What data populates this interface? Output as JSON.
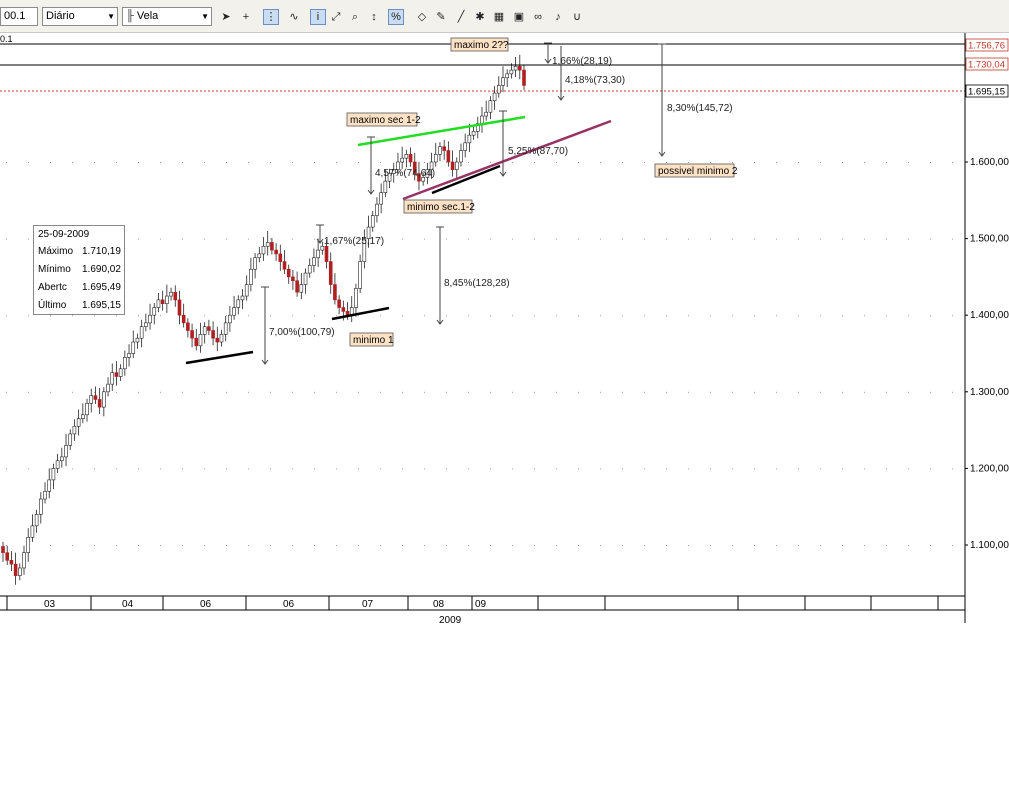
{
  "toolbar": {
    "symbol_value": "00.1",
    "period_value": "Diário",
    "style_value": "Vela",
    "symbol_short": "0.1"
  },
  "info_box": {
    "date": "25-09-2009",
    "rows": [
      {
        "label": "Máximo",
        "value": "1.710,19"
      },
      {
        "label": "Mínimo",
        "value": "1.690,02"
      },
      {
        "label": "Abertc",
        "value": "1.695,49"
      },
      {
        "label": "Último",
        "value": "1.695,15"
      }
    ]
  },
  "chart_data": {
    "type": "candlestick",
    "y_axis": {
      "ticks": [
        "1.100,00",
        "1.200,00",
        "1.300,00",
        "1.400,00",
        "1.500,00",
        "1.600,00"
      ],
      "tick_values": [
        1100,
        1200,
        1300,
        1400,
        1500,
        1600
      ],
      "ylim": [
        1035,
        1790
      ],
      "price_tags": [
        {
          "label": "1.756,76",
          "value": 1756.76,
          "color": "#c0392b"
        },
        {
          "label": "1.730,04",
          "value": 1730.04,
          "color": "#c0392b"
        },
        {
          "label": "1.695,15",
          "value": 1695.15,
          "color": "#000000"
        }
      ]
    },
    "x_axis": {
      "month_labels": [
        "03",
        "04",
        "06",
        "06",
        "07",
        "08",
        "09"
      ],
      "year_label": "2009"
    },
    "closes": [
      1090,
      1080,
      1075,
      1060,
      1070,
      1090,
      1110,
      1125,
      1140,
      1160,
      1170,
      1185,
      1200,
      1210,
      1215,
      1230,
      1245,
      1255,
      1265,
      1270,
      1285,
      1295,
      1290,
      1280,
      1300,
      1310,
      1325,
      1320,
      1330,
      1345,
      1350,
      1365,
      1370,
      1385,
      1390,
      1400,
      1410,
      1420,
      1415,
      1425,
      1430,
      1420,
      1400,
      1390,
      1380,
      1370,
      1360,
      1375,
      1385,
      1380,
      1370,
      1365,
      1375,
      1390,
      1400,
      1410,
      1420,
      1425,
      1440,
      1460,
      1475,
      1480,
      1490,
      1495,
      1485,
      1480,
      1470,
      1460,
      1450,
      1445,
      1430,
      1440,
      1455,
      1465,
      1475,
      1485,
      1490,
      1470,
      1440,
      1420,
      1410,
      1405,
      1400,
      1410,
      1435,
      1470,
      1500,
      1515,
      1530,
      1545,
      1560,
      1575,
      1585,
      1590,
      1600,
      1605,
      1610,
      1600,
      1585,
      1575,
      1580,
      1590,
      1600,
      1610,
      1620,
      1615,
      1600,
      1590,
      1600,
      1615,
      1625,
      1635,
      1640,
      1650,
      1660,
      1665,
      1680,
      1690,
      1700,
      1710,
      1715,
      1720,
      1725,
      1720,
      1700
    ],
    "annotations": {
      "labels": [
        "maximo 2??",
        "maximo sec 1-2",
        "minimo sec.1-2",
        "minimo 1",
        "possivel minimo 2"
      ],
      "measures": [
        "1,66%(28,19)",
        "4,18%(73,30)",
        "8,30%(145,72)",
        "5,25%(87,70)",
        "4,57%(74,64)",
        "1,67%(25,17)",
        "8,45%(128,28)",
        "7,00%(100,79)"
      ]
    }
  }
}
